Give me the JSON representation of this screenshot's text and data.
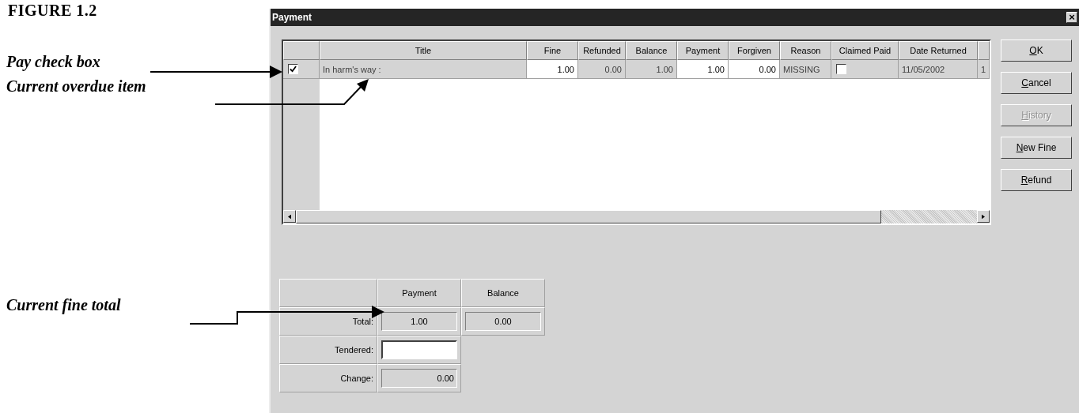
{
  "figure_title": "FIGURE 1.2",
  "callouts": [
    {
      "label": "Pay check box"
    },
    {
      "label": "Current overdue item"
    },
    {
      "label": "Current fine total"
    }
  ],
  "window": {
    "title": "Payment",
    "close": "×"
  },
  "grid": {
    "columns": [
      "Title",
      "Fine",
      "Refunded",
      "Balance",
      "Payment",
      "Forgiven",
      "Reason",
      "Claimed Paid",
      "Date Returned"
    ],
    "rows": [
      {
        "checked": true,
        "cells": [
          {
            "kind": "readonly",
            "value": "In harm's way :"
          },
          {
            "kind": "editable",
            "value": "1.00"
          },
          {
            "kind": "readonly",
            "value": "0.00"
          },
          {
            "kind": "readonly",
            "value": "1.00"
          },
          {
            "kind": "editable",
            "value": "1.00"
          },
          {
            "kind": "editable",
            "value": "0.00"
          },
          {
            "kind": "readonly",
            "value": "MISSING"
          },
          {
            "kind": "check",
            "checked": false
          },
          {
            "kind": "readonly",
            "value": "11/05/2002"
          },
          {
            "kind": "readonly",
            "value": "1"
          }
        ]
      }
    ]
  },
  "buttons": [
    {
      "key": "O",
      "rest": "K",
      "disabled": false
    },
    {
      "key": "C",
      "rest": "ancel",
      "disabled": false
    },
    {
      "key": "H",
      "rest": "istory",
      "disabled": true
    },
    {
      "key": "N",
      "rest": "ew Fine",
      "disabled": false
    },
    {
      "key": "R",
      "rest": "efund",
      "disabled": false
    }
  ],
  "summary": {
    "columns": [
      "Payment",
      "Balance"
    ],
    "rows": [
      {
        "label": "Total:",
        "cells": [
          {
            "kind": "readonly",
            "value": "1.00"
          },
          {
            "kind": "readonly",
            "value": "0.00"
          }
        ]
      },
      {
        "label": "Tendered:",
        "cells": [
          {
            "kind": "input"
          }
        ]
      },
      {
        "label": "Change:",
        "cells": [
          {
            "kind": "readonly",
            "value": "0.00"
          }
        ]
      }
    ]
  }
}
